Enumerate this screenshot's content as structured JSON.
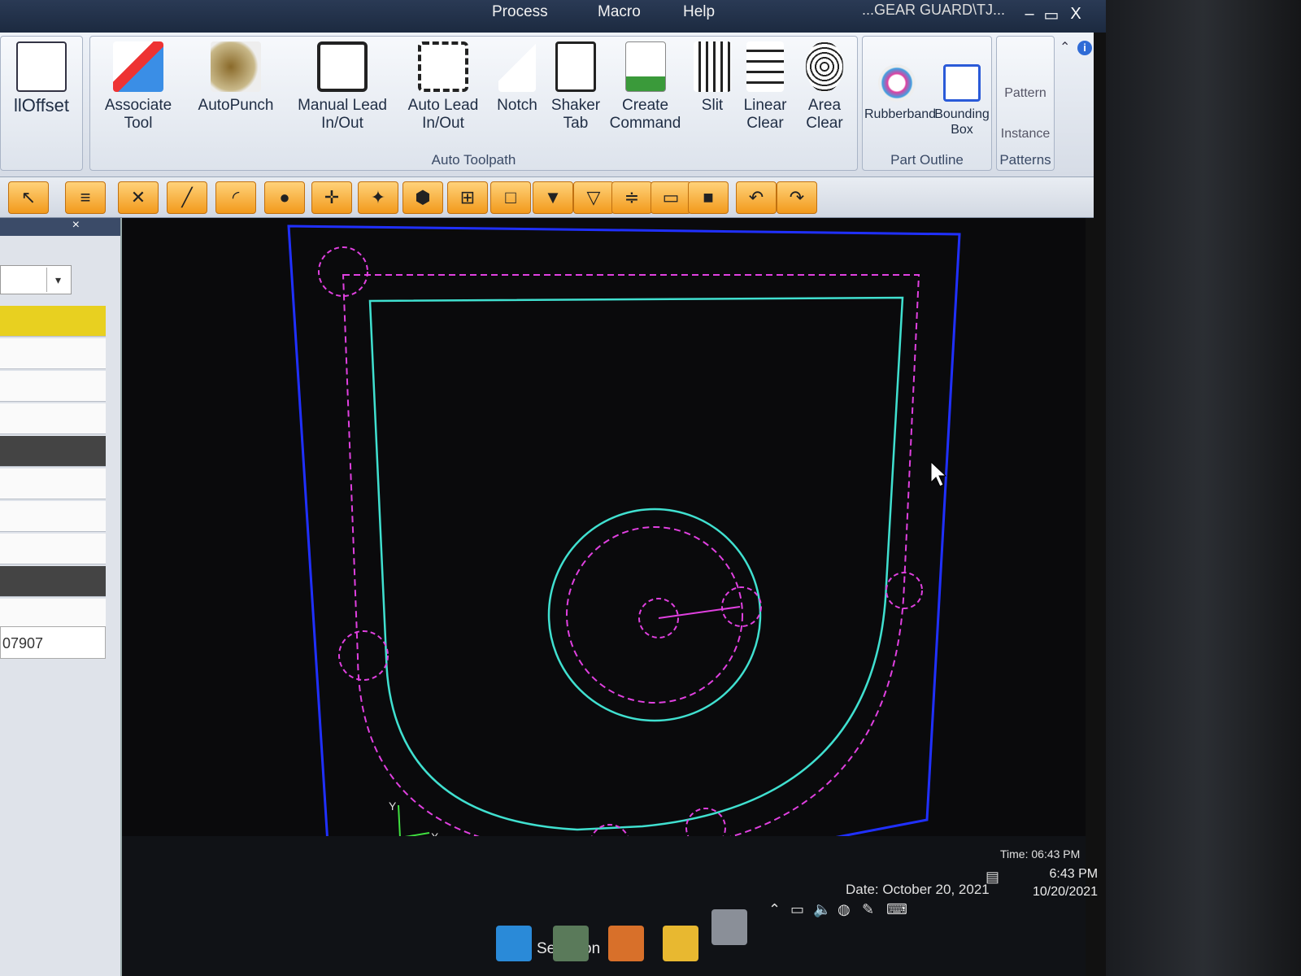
{
  "window": {
    "title": "...GEAR GUARD\\TJ...",
    "menus": [
      {
        "label": "Process"
      },
      {
        "label": "Macro"
      },
      {
        "label": "Help"
      }
    ],
    "minimize": "‒",
    "maximize": "▭",
    "close": "X"
  },
  "ribbon": {
    "partial_button": "llOffset",
    "auto_toolpath": {
      "label": "Auto Toolpath",
      "buttons": [
        {
          "line1": "Associate",
          "line2": "Tool"
        },
        {
          "line1": "AutoPunch",
          "line2": ""
        },
        {
          "line1": "Manual Lead",
          "line2": "In/Out"
        },
        {
          "line1": "Auto Lead",
          "line2": "In/Out"
        },
        {
          "line1": "Notch",
          "line2": ""
        },
        {
          "line1": "Shaker",
          "line2": "Tab"
        },
        {
          "line1": "Create",
          "line2": "Command"
        },
        {
          "line1": "Slit",
          "line2": ""
        },
        {
          "line1": "Linear",
          "line2": "Clear"
        },
        {
          "line1": "Area Clear",
          "line2": ""
        }
      ]
    },
    "part_outline": {
      "label": "Part Outline",
      "buttons": [
        {
          "line1": "Rubberband",
          "line2": ""
        },
        {
          "line1": "Bounding",
          "line2": "Box"
        }
      ]
    },
    "patterns": {
      "label": "Patterns",
      "buttons": [
        {
          "line1": "Pattern"
        },
        {
          "line1": "Instance"
        }
      ]
    }
  },
  "left_panel": {
    "close": "×",
    "value": "07907"
  },
  "canvas": {
    "axis_y": "Y",
    "axis_x": "X"
  },
  "status": {
    "selection": "Selection",
    "date": "Date: October 20, 2021",
    "time": "Time: 06:43 PM",
    "tray_time": "6:43 PM",
    "tray_date": "10/20/2021"
  },
  "colors": {
    "part_outline": "#40e0d0",
    "tool_path": "#e040e0",
    "sheet_border": "#2030ff",
    "accent_orange": "#f29a1c"
  }
}
